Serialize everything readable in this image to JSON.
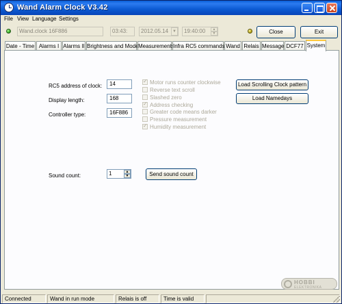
{
  "window": {
    "title": "Wand Alarm Clock V3.42"
  },
  "menu": {
    "items": [
      "File",
      "View",
      "Language",
      "Settings"
    ]
  },
  "toolbar": {
    "device_value": "Wand.clock 16F886",
    "time_short": "03:43:",
    "date_value": "2012.05.14",
    "time_value": "19:40:00",
    "close_label": "Close",
    "exit_label": "Exit"
  },
  "tabs": [
    "Date - Time",
    "Alarms I",
    "Alarms II",
    "Brightness and Mode",
    "Measurements",
    "Infra RC5 commands",
    "Wand",
    "Relais",
    "Message",
    "DCF77",
    "System"
  ],
  "system": {
    "rc5_label": "RC5 address of clock:",
    "rc5_value": "14",
    "display_length_label": "Display length:",
    "display_length_value": "168",
    "controller_label": "Controller type:",
    "controller_value": "16F886",
    "options": [
      {
        "label": "Motor runs counter clockwise",
        "checked": true
      },
      {
        "label": "Reverse text scroll",
        "checked": false
      },
      {
        "label": "Slashed zero",
        "checked": false
      },
      {
        "label": "Address checking",
        "checked": true
      },
      {
        "label": "Greater code means darker",
        "checked": false
      },
      {
        "label": "Pressure measurement",
        "checked": false
      },
      {
        "label": "Humidity measurement",
        "checked": true
      }
    ],
    "load_scroll_label": "Load Scrolling Clock pattern",
    "load_namedays_label": "Load Namedays",
    "sound_count_label": "Sound count:",
    "sound_count_value": "1",
    "send_sound_label": "Send sound count"
  },
  "logo": {
    "text": "HOBBI",
    "sub": "ELEKTRONIKA"
  },
  "status": {
    "connection": "Connected",
    "mode": "Wand in run mode",
    "relais": "Relais is off",
    "time": "Time is valid"
  },
  "colors": {
    "titlebar": "#0A5FD8",
    "active_tab_accent": "#FFC83C",
    "led_green": "#20a010",
    "led_yellow": "#b09a08"
  }
}
